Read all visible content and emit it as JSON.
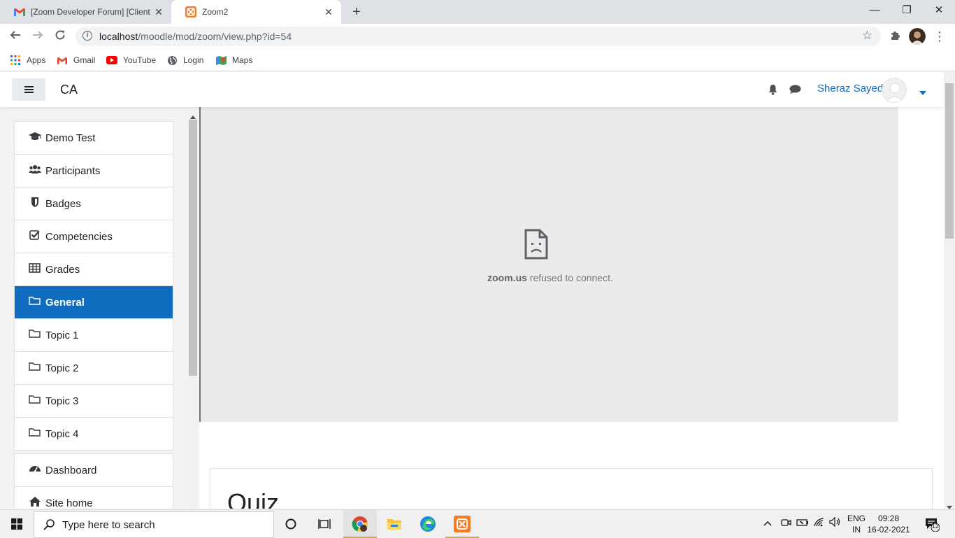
{
  "browser": {
    "tabs": [
      {
        "title": "[Zoom Developer Forum] [Client",
        "favicon": "gmail-icon",
        "active": false
      },
      {
        "title": "Zoom2",
        "favicon": "xampp-icon",
        "active": true
      }
    ],
    "url_host": "localhost",
    "url_path": "/moodle/mod/zoom/view.php?id=54",
    "bookmarks": [
      {
        "label": "Apps",
        "icon": "apps-grid-icon"
      },
      {
        "label": "Gmail",
        "icon": "gmail-icon"
      },
      {
        "label": "YouTube",
        "icon": "youtube-icon"
      },
      {
        "label": "Login",
        "icon": "globe-icon"
      },
      {
        "label": "Maps",
        "icon": "maps-icon"
      }
    ]
  },
  "header": {
    "site_name": "CA",
    "user_name": "Sheraz Sayed"
  },
  "nav": {
    "course_items": [
      {
        "label": "Demo Test",
        "icon": "graduation-cap-icon"
      },
      {
        "label": "Participants",
        "icon": "users-icon"
      },
      {
        "label": "Badges",
        "icon": "shield-icon"
      },
      {
        "label": "Competencies",
        "icon": "checkbox-icon"
      },
      {
        "label": "Grades",
        "icon": "table-icon"
      },
      {
        "label": "General",
        "icon": "folder-icon",
        "active": true
      },
      {
        "label": "Topic 1",
        "icon": "folder-icon"
      },
      {
        "label": "Topic 2",
        "icon": "folder-icon"
      },
      {
        "label": "Topic 3",
        "icon": "folder-icon"
      },
      {
        "label": "Topic 4",
        "icon": "folder-icon"
      }
    ],
    "site_items": [
      {
        "label": "Dashboard",
        "icon": "dashboard-icon"
      },
      {
        "label": "Site home",
        "icon": "home-icon"
      }
    ]
  },
  "content": {
    "error_host": "zoom.us",
    "error_text": " refused to connect.",
    "quiz_title": "Quiz"
  },
  "taskbar": {
    "search_placeholder": "Type here to search",
    "lang_line1": "ENG",
    "lang_line2": "IN",
    "time": "09:28",
    "date": "16-02-2021",
    "notification_count": "12"
  },
  "colors": {
    "accent": "#0f6cbf",
    "iframe_bg": "#ebebeb"
  }
}
